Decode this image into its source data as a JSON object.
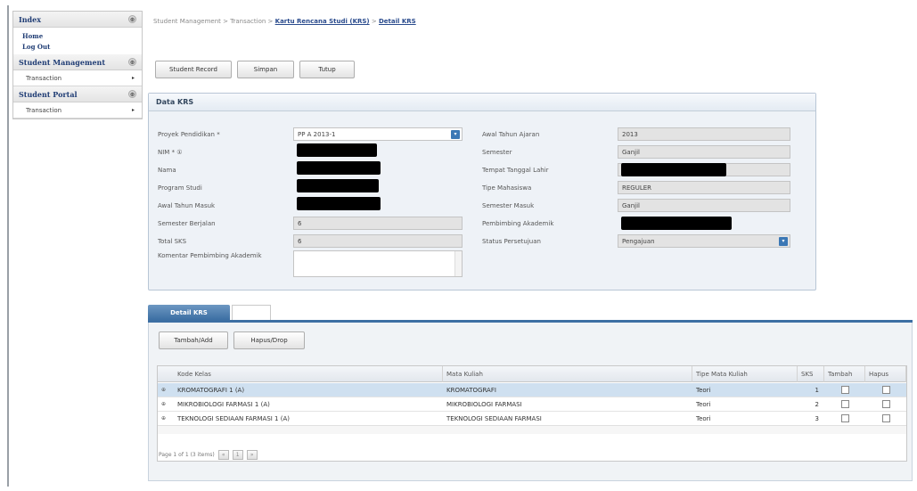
{
  "sidebar": {
    "sections": [
      {
        "title": "Index",
        "toggle": "⊕",
        "links": [
          "Home",
          "Log Out"
        ]
      },
      {
        "title": "Student Management",
        "toggle": "⊕",
        "items": [
          "Transaction"
        ]
      },
      {
        "title": "Student Portal",
        "toggle": "⊕",
        "items": [
          "Transaction"
        ]
      }
    ],
    "arrow": "▸"
  },
  "breadcrumb": {
    "part1": "Student Management",
    "sep": ">",
    "part2": "Transaction",
    "part3": "Kartu Rencana Studi (KRS)",
    "part4": "Detail KRS"
  },
  "toolbar": {
    "student_record": "Student Record",
    "simpan": "Simpan",
    "tutup": "Tutup"
  },
  "data_krs": {
    "title": "Data KRS",
    "left": {
      "proyek_label": "Proyek Pendidikan *",
      "proyek_value": "PP A 2013-1",
      "nim_label": "NIM * ①",
      "nama_label": "Nama",
      "prodi_label": "Program Studi",
      "awal_masuk_label": "Awal Tahun Masuk",
      "semester_berjalan_label": "Semester Berjalan",
      "semester_berjalan_value": "6",
      "total_sks_label": "Total SKS",
      "total_sks_value": "6",
      "komentar_label": "Komentar Pembimbing Akademik"
    },
    "right": {
      "awal_ajaran_label": "Awal Tahun Ajaran",
      "awal_ajaran_value": "2013",
      "semester_label": "Semester",
      "semester_value": "Ganjil",
      "ttl_label": "Tempat Tanggal Lahir",
      "tipe_mhs_label": "Tipe Mahasiswa",
      "tipe_mhs_value": "REGULER",
      "semester_masuk_label": "Semester Masuk",
      "semester_masuk_value": "Ganjil",
      "pembimbing_label": "Pembimbing Akademik",
      "status_label": "Status Persetujuan",
      "status_value": "Pengajuan"
    }
  },
  "detail": {
    "tab_label": "Detail KRS",
    "add_button": "Tambah/Add",
    "drop_button": "Hapus/Drop",
    "columns": [
      "Kode Kelas",
      "Mata Kuliah",
      "Tipe Mata Kuliah",
      "SKS",
      "Tambah",
      "Hapus"
    ],
    "rows": [
      {
        "kode": "KROMATOGRAFI 1 (A)",
        "mata_kuliah": "KROMATOGRAFI",
        "tipe": "Teori",
        "sks": "1"
      },
      {
        "kode": "MIKROBIOLOGI FARMASI 1 (A)",
        "mata_kuliah": "MIKROBIOLOGI FARMASI",
        "tipe": "Teori",
        "sks": "2"
      },
      {
        "kode": "TEKNOLOGI SEDIAAN FARMASI 1 (A)",
        "mata_kuliah": "TEKNOLOGI SEDIAAN FARMASI",
        "tipe": "Teori",
        "sks": "3"
      }
    ],
    "expander": "⊕",
    "pager_text": "Page 1 of 1 (3 items)"
  },
  "colors": {
    "link": "#2a4b8d",
    "tab_blue": "#3c6fa3",
    "selected_row": "#cfe0f0",
    "dropdown_button": "#3b78b5"
  }
}
